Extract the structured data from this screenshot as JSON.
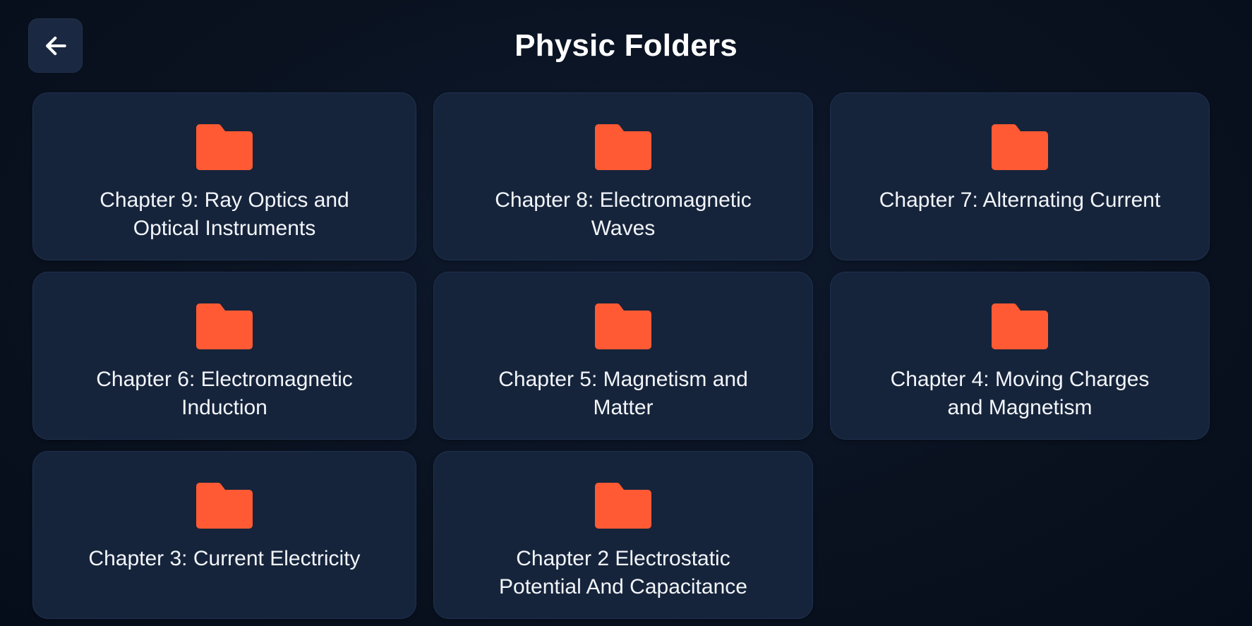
{
  "header": {
    "title": "Physic Folders",
    "back_icon": "arrow-left-icon"
  },
  "colors": {
    "background": "#0a1220",
    "card": "#16243b",
    "folder": "#ff5a33",
    "text": "#ffffff"
  },
  "folders": [
    {
      "label": "Chapter 9: Ray Optics and Optical Instruments",
      "icon": "folder-icon"
    },
    {
      "label": "Chapter 8: Electromagnetic Waves",
      "icon": "folder-icon"
    },
    {
      "label": "Chapter 7: Alternating Current",
      "icon": "folder-icon"
    },
    {
      "label": "Chapter 6: Electromagnetic Induction",
      "icon": "folder-icon"
    },
    {
      "label": "Chapter 5: Magnetism and Matter",
      "icon": "folder-icon"
    },
    {
      "label": "Chapter 4: Moving Charges and Magnetism",
      "icon": "folder-icon"
    },
    {
      "label": "Chapter 3: Current Electricity",
      "icon": "folder-icon"
    },
    {
      "label": "Chapter 2 Electrostatic Potential And Capacitance",
      "icon": "folder-icon"
    }
  ]
}
